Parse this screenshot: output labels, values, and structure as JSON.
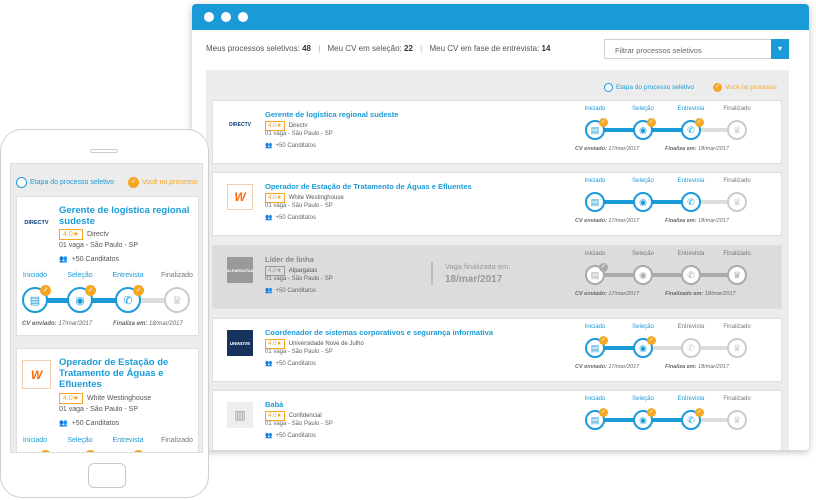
{
  "colors": {
    "accent": "#1a9bd7",
    "check": "#f5a623",
    "inactive": "#aaaaaa"
  },
  "stats": {
    "processes_label": "Meus processos seletivos:",
    "processes_count": "48",
    "cv_selection_label": "Meu CV em seleção:",
    "cv_selection_count": "22",
    "cv_interview_label": "Meu CV em fase de entrevista:",
    "cv_interview_count": "14"
  },
  "filter": {
    "placeholder": "Filtrar processos seletivos",
    "chevron_icon": "chevron-down-icon"
  },
  "legend": {
    "stage_label": "Etapa do processo seletivo",
    "you_label": "Você no processo"
  },
  "stage_names": [
    "Iniciado",
    "Seleção",
    "Entrevista",
    "Finalizado"
  ],
  "stage_icons": [
    "document-icon",
    "eye-icon",
    "phone-icon",
    "trophy-icon"
  ],
  "cards": [
    {
      "title": "Gerente de logística regional sudeste",
      "rating": "4.0★",
      "company": "Directv",
      "logo_text": "DIRECTV",
      "location": "01 vaga - São Paulo - SP",
      "candidates": "+50 Canditatos",
      "progress": 3,
      "checks": 3,
      "cv_label": "CV enviado:",
      "cv_date": "17/mar/2017",
      "final_label": "Finaliza em:",
      "final_date": "18/mar/2017"
    },
    {
      "title": "Operador de Estação de Tratamento de Águas e Efluentes",
      "rating": "4.0★",
      "company": "White Westinghouse",
      "logo_text": "W",
      "location": "01 vaga - São Paulo - SP",
      "candidates": "+50 Canditatos",
      "progress": 3,
      "checks": 0,
      "cv_label": "CV enviado:",
      "cv_date": "17/mar/2017",
      "final_label": "Finaliza em:",
      "final_date": "18/mar/2017"
    },
    {
      "title": "Líder de linha",
      "rating": "4.0★",
      "company": "Alpargatas",
      "logo_text": "ALPARGATAS",
      "location": "01 vaga - São Paulo - SP",
      "candidates": "+50 Canditatos",
      "progress": 4,
      "checks": 1,
      "inactive": true,
      "closed_label": "Vaga finalizada em:",
      "closed_date": "18/mar/2017",
      "cv_label": "CV enviado:",
      "cv_date": "17/mar/2017",
      "final_label": "Finalizado em:",
      "final_date": "18/mar/2017"
    },
    {
      "title": "Coordenador de sistemas corporativos e segurança informativa",
      "rating": "4.0★",
      "company": "Universidade Nove de Julho",
      "logo_text": "UNINOVE",
      "location": "01 vaga - São Paulo - SP",
      "candidates": "+50 Canditatos",
      "progress": 2,
      "checks": 2,
      "cv_label": "CV enviado:",
      "cv_date": "17/mar/2017",
      "final_label": "Finaliza em:",
      "final_date": "18/mar/2017"
    },
    {
      "title": "Babá",
      "rating": "4.0★",
      "company": "Confidencial",
      "logo_text": "",
      "location": "01 vaga - São Paulo - SP",
      "candidates": "+50 Canditatos",
      "progress": 3,
      "checks": 3,
      "cv_label": "",
      "cv_date": "",
      "final_label": "",
      "final_date": ""
    }
  ],
  "mobile": {
    "cards": [
      {
        "title": "Gerente de logística regional sudeste",
        "rating": "4.0★",
        "company": "Directv",
        "logo_text": "DIRECTV",
        "location": "01 vaga - São Paulo - SP",
        "candidates": "+50 Canditatos",
        "progress": 3,
        "checks": 3,
        "cv_label": "CV enviado:",
        "cv_date": "17/mar/2017",
        "final_label": "Finaliza em:",
        "final_date": "18/mar/2017"
      },
      {
        "title": "Operador de Estação de Tratamento de Águas e Efluentes",
        "rating": "4.0★",
        "company": "White Westinghouse",
        "logo_text": "W",
        "location": "01 vaga - São Paulo - SP",
        "candidates": "+50 Canditatos",
        "progress": 3,
        "checks": 3
      }
    ]
  }
}
